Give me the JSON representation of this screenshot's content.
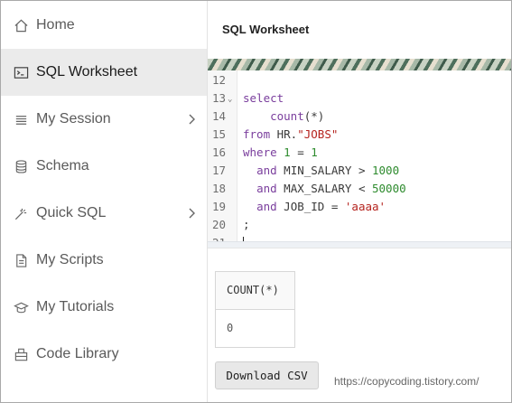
{
  "sidebar": {
    "items": [
      {
        "label": "Home",
        "icon": "home-icon",
        "active": false,
        "chevron": false
      },
      {
        "label": "SQL Worksheet",
        "icon": "terminal-icon",
        "active": true,
        "chevron": false
      },
      {
        "label": "My Session",
        "icon": "list-icon",
        "active": false,
        "chevron": true
      },
      {
        "label": "Schema",
        "icon": "database-icon",
        "active": false,
        "chevron": false
      },
      {
        "label": "Quick SQL",
        "icon": "magic-wand-icon",
        "active": false,
        "chevron": true
      },
      {
        "label": "My Scripts",
        "icon": "document-icon",
        "active": false,
        "chevron": false
      },
      {
        "label": "My Tutorials",
        "icon": "graduation-cap-icon",
        "active": false,
        "chevron": false
      },
      {
        "label": "Code Library",
        "icon": "library-icon",
        "active": false,
        "chevron": false
      }
    ]
  },
  "header": {
    "title": "SQL Worksheet"
  },
  "editor": {
    "lines": [
      {
        "num": "12",
        "text": ""
      },
      {
        "num": "13",
        "text": "select"
      },
      {
        "num": "14",
        "text": "    count(*)"
      },
      {
        "num": "15",
        "text": "from HR.\"JOBS\""
      },
      {
        "num": "16",
        "text": "where 1 = 1"
      },
      {
        "num": "17",
        "text": "  and MIN_SALARY > 1000"
      },
      {
        "num": "18",
        "text": "  and MAX_SALARY < 50000"
      },
      {
        "num": "19",
        "text": "  and JOB_ID = 'aaaa'"
      },
      {
        "num": "20",
        "text": ";"
      },
      {
        "num": "21",
        "text": ""
      }
    ]
  },
  "results": {
    "column": "COUNT(*)",
    "value": "0"
  },
  "download_button": "Download CSV",
  "watermark": "https://copycoding.tistory.com/",
  "colors": {
    "keyword": "#7a3e9d",
    "string": "#b5231e",
    "number": "#2e8b2e",
    "active_bg": "#ebebeb"
  }
}
